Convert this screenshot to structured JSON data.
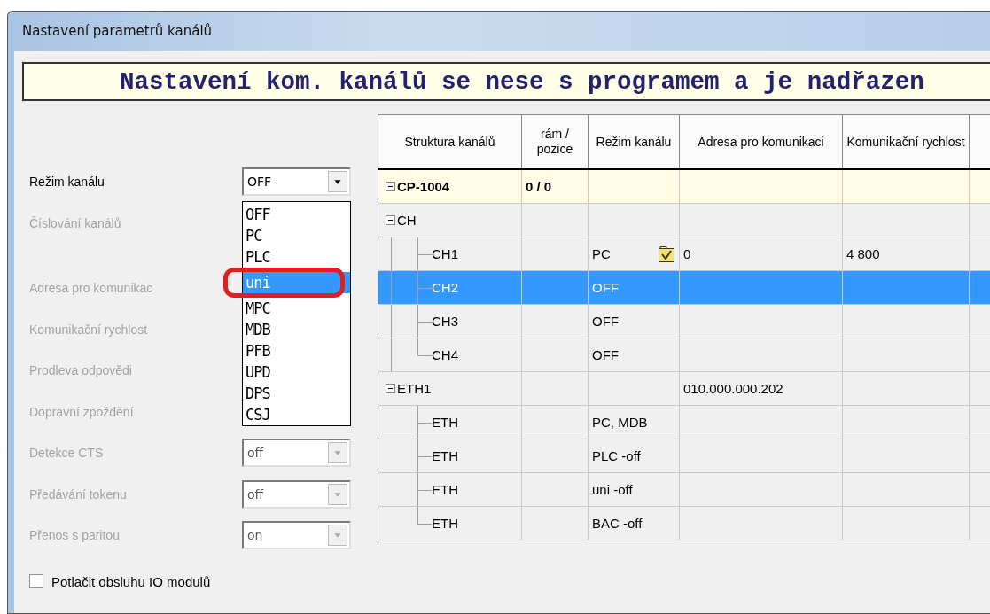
{
  "window": {
    "title": "Nastavení parametrů kanálů"
  },
  "banner": "Nastavení kom. kanálů se nese s programem a je nadřazen",
  "form": {
    "fields": [
      {
        "label": "Režim kanálu",
        "disabled": false,
        "value": "OFF",
        "open": true,
        "options": [
          {
            "label": "OFF",
            "highlighted": false,
            "circled": false
          },
          {
            "label": "PC",
            "highlighted": false,
            "circled": false
          },
          {
            "label": "PLC",
            "highlighted": false,
            "circled": false
          },
          {
            "label": "uni",
            "highlighted": true,
            "circled": true
          },
          {
            "label": "MPC",
            "highlighted": false,
            "circled": false
          },
          {
            "label": "MDB",
            "highlighted": false,
            "circled": false
          },
          {
            "label": "PFB",
            "highlighted": false,
            "circled": false
          },
          {
            "label": "UPD",
            "highlighted": false,
            "circled": false
          },
          {
            "label": "DPS",
            "highlighted": false,
            "circled": false
          },
          {
            "label": "CSJ",
            "highlighted": false,
            "circled": false
          }
        ]
      },
      {
        "label": "Číslování kanálů",
        "disabled": true
      },
      {
        "label": "Adresa pro komunikac",
        "disabled": true
      },
      {
        "label": "Komunikační rychlost",
        "disabled": true
      },
      {
        "label": "Prodleva odpovědi",
        "disabled": true
      },
      {
        "label": "Dopravní zpoždění",
        "disabled": true
      },
      {
        "label": "Detekce CTS",
        "disabled": true,
        "value": "off"
      },
      {
        "label": "Předávání tokenu",
        "disabled": true,
        "value": "off"
      },
      {
        "label": "Přenos s paritou",
        "disabled": true,
        "value": "on"
      }
    ],
    "checkbox": {
      "label": "Potlačit obsluhu IO modulů",
      "checked": false
    }
  },
  "table": {
    "columns": [
      "Struktura kanálů",
      "rám / pozice",
      "Režim kanálu",
      "Adresa pro komunikaci",
      "Komunikační rychlost"
    ],
    "rows": [
      {
        "name": "CP-1004",
        "frame": "0 / 0",
        "root": true,
        "expanded": true,
        "selected": false,
        "marked": false,
        "children": [
          {
            "name": "CH",
            "expanded": true,
            "selected": false,
            "marked": false,
            "children": [
              {
                "name": "CH1",
                "mode": "PC",
                "address": "0",
                "speed": "4 800",
                "selected": false,
                "marked": true
              },
              {
                "name": "CH2",
                "mode": "OFF",
                "selected": true,
                "marked": false
              },
              {
                "name": "CH3",
                "mode": "OFF",
                "selected": false,
                "marked": false
              },
              {
                "name": "CH4",
                "mode": "OFF",
                "selected": false,
                "marked": false
              }
            ]
          },
          {
            "name": "ETH1",
            "address": "010.000.000.202",
            "expanded": true,
            "selected": false,
            "marked": false,
            "children": [
              {
                "name": "ETH",
                "mode": "PC, MDB",
                "selected": false,
                "marked": false
              },
              {
                "name": "ETH",
                "mode": "PLC -off",
                "selected": false,
                "marked": false
              },
              {
                "name": "ETH",
                "mode": "uni -off",
                "selected": false,
                "marked": false
              },
              {
                "name": "ETH",
                "mode": "BAC -off",
                "selected": false,
                "marked": false
              }
            ]
          }
        ]
      }
    ]
  }
}
